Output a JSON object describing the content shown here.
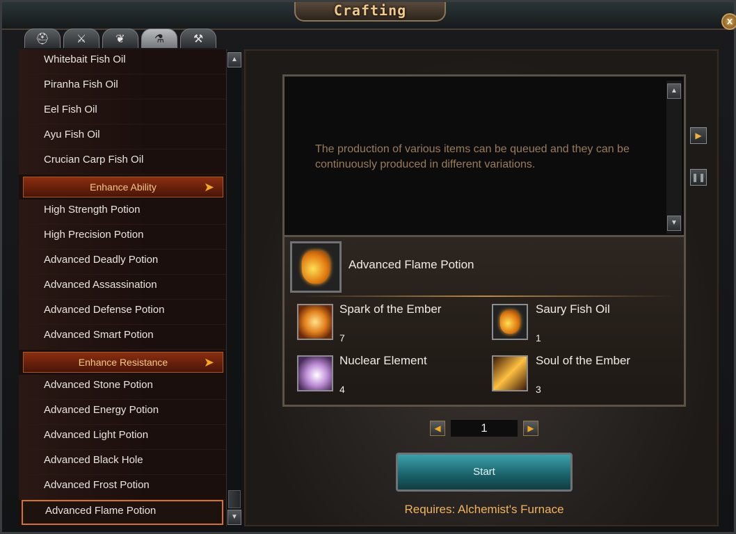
{
  "window": {
    "title": "Crafting",
    "close_glyph": "x"
  },
  "tabs": [
    {
      "icon": "helmet-icon",
      "glyph": "⛑",
      "active": false
    },
    {
      "icon": "sword-icon",
      "glyph": "⚔",
      "active": false
    },
    {
      "icon": "accessory-icon",
      "glyph": "❦",
      "active": false
    },
    {
      "icon": "potion-icon",
      "glyph": "⚗",
      "active": true
    },
    {
      "icon": "hammer-icon",
      "glyph": "⚒",
      "active": false
    }
  ],
  "list": {
    "items": [
      {
        "type": "item",
        "label": "Whitebait Fish Oil"
      },
      {
        "type": "item",
        "label": "Piranha Fish Oil"
      },
      {
        "type": "item",
        "label": "Eel Fish Oil"
      },
      {
        "type": "item",
        "label": "Ayu Fish Oil"
      },
      {
        "type": "item",
        "label": "Crucian Carp Fish Oil"
      },
      {
        "type": "header",
        "label": "Enhance Ability"
      },
      {
        "type": "item",
        "label": "High Strength Potion"
      },
      {
        "type": "item",
        "label": "High Precision Potion"
      },
      {
        "type": "item",
        "label": "Advanced Deadly Potion"
      },
      {
        "type": "item",
        "label": "Advanced Assassination"
      },
      {
        "type": "item",
        "label": "Advanced Defense Potion"
      },
      {
        "type": "item",
        "label": "Advanced Smart Potion"
      },
      {
        "type": "header",
        "label": "Enhance Resistance"
      },
      {
        "type": "item",
        "label": "Advanced Stone Potion"
      },
      {
        "type": "item",
        "label": "Advanced Energy Potion"
      },
      {
        "type": "item",
        "label": "Advanced Light Potion"
      },
      {
        "type": "item",
        "label": "Advanced Black Hole"
      },
      {
        "type": "item",
        "label": "Advanced Frost Potion"
      },
      {
        "type": "item",
        "label": "Advanced Flame Potion",
        "selected": true
      }
    ]
  },
  "description": {
    "text": "The production of various items can be queued and they can be continuously produced in different variations."
  },
  "recipe": {
    "name": "Advanced Flame Potion",
    "icon": "flame-potion-icon",
    "materials": [
      {
        "name": "Spark of the Ember",
        "count": "7",
        "icon": "ember-icon"
      },
      {
        "name": "Saury Fish Oil",
        "count": "1",
        "icon": "fish-oil-icon"
      },
      {
        "name": "Nuclear Element",
        "count": "4",
        "icon": "nuclear-element-icon"
      },
      {
        "name": "Soul of the Ember",
        "count": "3",
        "icon": "soul-ember-icon"
      }
    ]
  },
  "quantity": {
    "value": "1"
  },
  "actions": {
    "start_label": "Start",
    "requires": "Requires: Alchemist's Furnace"
  },
  "colors": {
    "accent": "#f3a81c",
    "header_bg": "#8a2e10",
    "start_bg": "#1a6068"
  }
}
